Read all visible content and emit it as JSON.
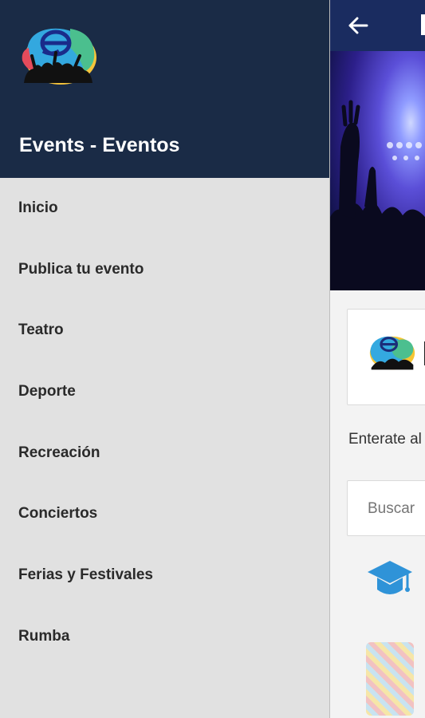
{
  "drawer": {
    "title": "Events - Eventos",
    "items": [
      {
        "label": "Inicio"
      },
      {
        "label": "Publica tu evento"
      },
      {
        "label": "Teatro"
      },
      {
        "label": "Deporte"
      },
      {
        "label": "Recreación"
      },
      {
        "label": "Conciertos"
      },
      {
        "label": "Ferias y Festivales"
      },
      {
        "label": "Rumba"
      }
    ]
  },
  "main": {
    "subtitle": "Enterate al",
    "search_placeholder": "Buscar"
  },
  "icons": {
    "back": "arrow-left-icon",
    "category": "graduation-cap-icon"
  },
  "colors": {
    "drawer_header": "#1a2b46",
    "appbar": "#1a2c60",
    "drawer_bg": "#e1e1e1",
    "accent": "#2f93d8"
  }
}
